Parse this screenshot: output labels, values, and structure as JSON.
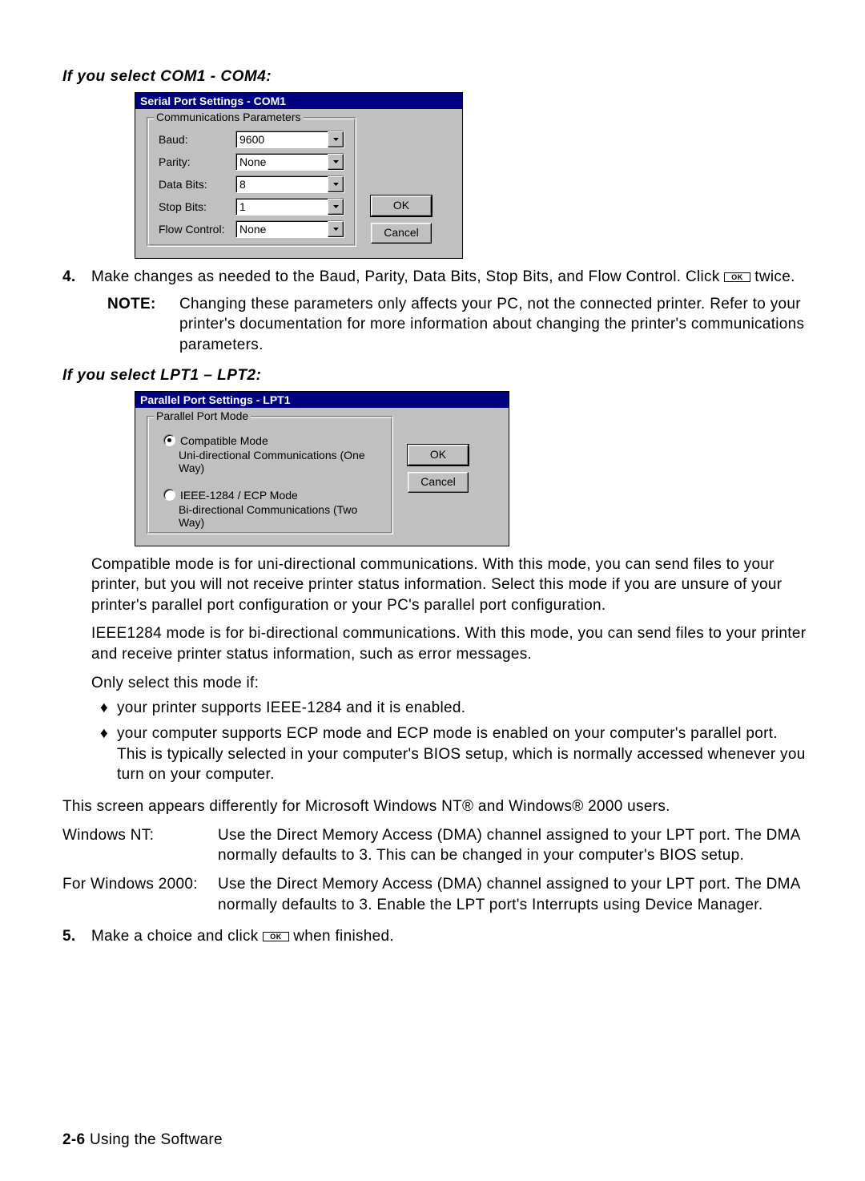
{
  "headings": {
    "com": "If you select COM1 - COM4:",
    "lpt": "If you select LPT1 – LPT2:"
  },
  "com_dialog": {
    "title": "Serial Port Settings - COM1",
    "group_title": "Communications Parameters",
    "rows": {
      "baud_label": "Baud:",
      "baud_value": "9600",
      "parity_label": "Parity:",
      "parity_value": "None",
      "databits_label": "Data Bits:",
      "databits_value": "8",
      "stopbits_label": "Stop Bits:",
      "stopbits_value": "1",
      "flow_label": "Flow Control:",
      "flow_value": "None"
    },
    "ok": "OK",
    "cancel": "Cancel"
  },
  "lpt_dialog": {
    "title": "Parallel Port Settings - LPT1",
    "group_title": "Parallel Port Mode",
    "opt1_label": "Compatible Mode",
    "opt1_desc": "Uni-directional Communications (One Way)",
    "opt2_label": "IEEE-1284 / ECP Mode",
    "opt2_desc": "Bi-directional Communications (Two Way)",
    "ok": "OK",
    "cancel": "Cancel"
  },
  "step4": {
    "num": "4.",
    "text_a": "Make changes as needed to the Baud, Parity, Data Bits, Stop Bits, and Flow Control.  Click ",
    "btn": "OK",
    "text_b": " twice."
  },
  "note": {
    "label": "NOTE:",
    "body": "Changing these parameters only affects your PC, not the connected printer.  Refer to your printer's documentation for more information about changing the printer's communications parameters."
  },
  "para_compat": "Compatible mode is for uni-directional communications.  With this mode, you can send files to your printer, but you will not receive printer status information.  Select this mode if you are unsure of your printer's parallel port configuration or your PC's parallel port configuration.",
  "para_ieee": "IEEE1284 mode is for bi-directional communications.  With this mode, you can send files to your printer and receive printer status information, such as error messages.",
  "para_only": "Only select this mode if:",
  "bullets": {
    "b1": "your printer supports IEEE-1284 and it is enabled.",
    "b2": "your computer supports ECP mode and ECP mode is enabled on your computer's parallel port.  This is typically selected in your computer's BIOS setup, which is normally accessed whenever you turn on your computer."
  },
  "para_nt_intro": "This screen appears differently for Microsoft Windows NT® and Windows® 2000 users.",
  "os_nt_label": "Windows NT:",
  "os_nt_body": "Use the Direct Memory Access (DMA) channel assigned to your LPT port.  The DMA normally defaults to 3.  This can be changed in your computer's BIOS setup.",
  "os_2000_label": "For Windows 2000:",
  "os_2000_body": "Use the Direct Memory Access (DMA) channel assigned to your LPT port.  The DMA normally defaults to 3.  Enable the LPT port's Interrupts using Device Manager.",
  "step5": {
    "num": "5.",
    "text_a": "Make a choice and click ",
    "btn": "OK",
    "text_b": " when finished."
  },
  "footer": {
    "page": "2-6",
    "title": "  Using the Software"
  }
}
